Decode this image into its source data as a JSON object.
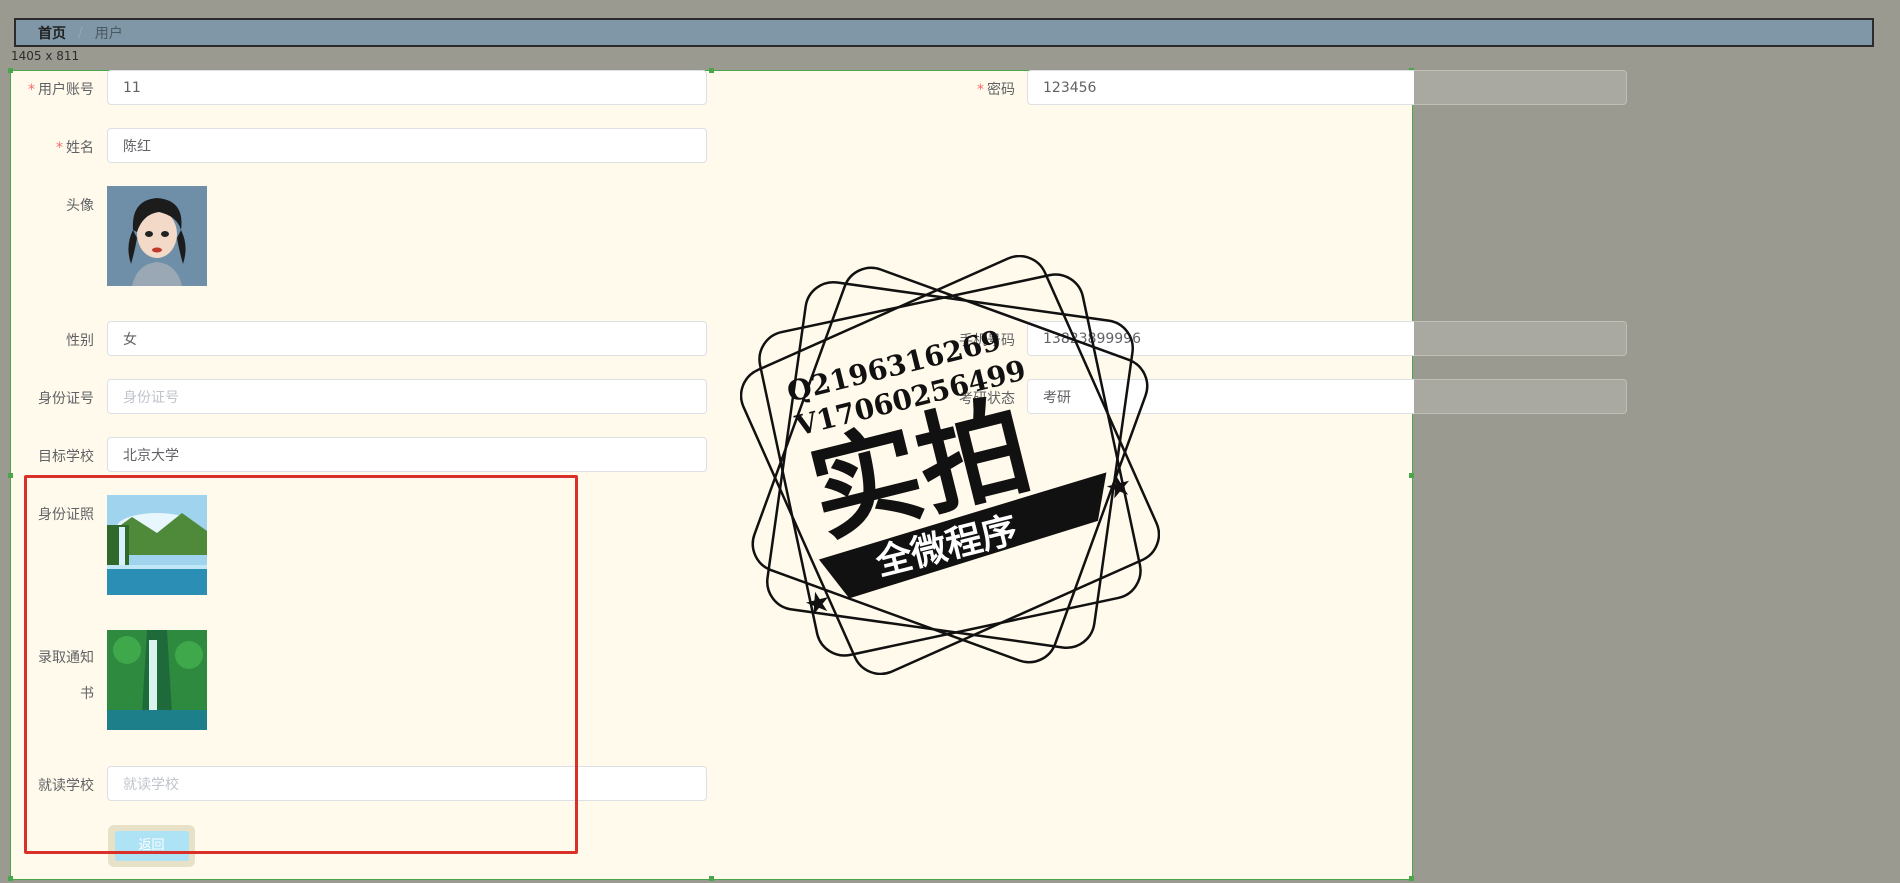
{
  "breadcrumb": {
    "home": "首页",
    "separator": "/",
    "current": "用户"
  },
  "size_tag": "1405 x 811",
  "form": {
    "account": {
      "label": "用户账号",
      "required": "*",
      "value": "11"
    },
    "password": {
      "label": "密码",
      "required": "*",
      "value": "123456"
    },
    "name": {
      "label": "姓名",
      "required": "*",
      "value": "陈红"
    },
    "avatar": {
      "label": "头像"
    },
    "gender": {
      "label": "性别",
      "value": "女"
    },
    "phone": {
      "label": "手机号码",
      "value": "13823899996"
    },
    "id_number": {
      "label": "身份证号",
      "placeholder": "身份证号"
    },
    "status": {
      "label": "考研状态",
      "value": "考研"
    },
    "target_school": {
      "label": "目标学校",
      "value": "北京大学"
    },
    "id_photo": {
      "label": "身份证照"
    },
    "admission_letter": {
      "label_line1": "录取通知",
      "label_line2": "书"
    },
    "current_school": {
      "label": "就读学校",
      "placeholder": "就读学校"
    },
    "back_button": "返回"
  },
  "watermark": {
    "line1": "Q2196316269",
    "line2": "V17060256499",
    "main": "实拍",
    "banner": "全微程序"
  },
  "colors": {
    "required": "#f56c6c",
    "selection": "#4aa64a",
    "highlight": "#d9302a"
  }
}
